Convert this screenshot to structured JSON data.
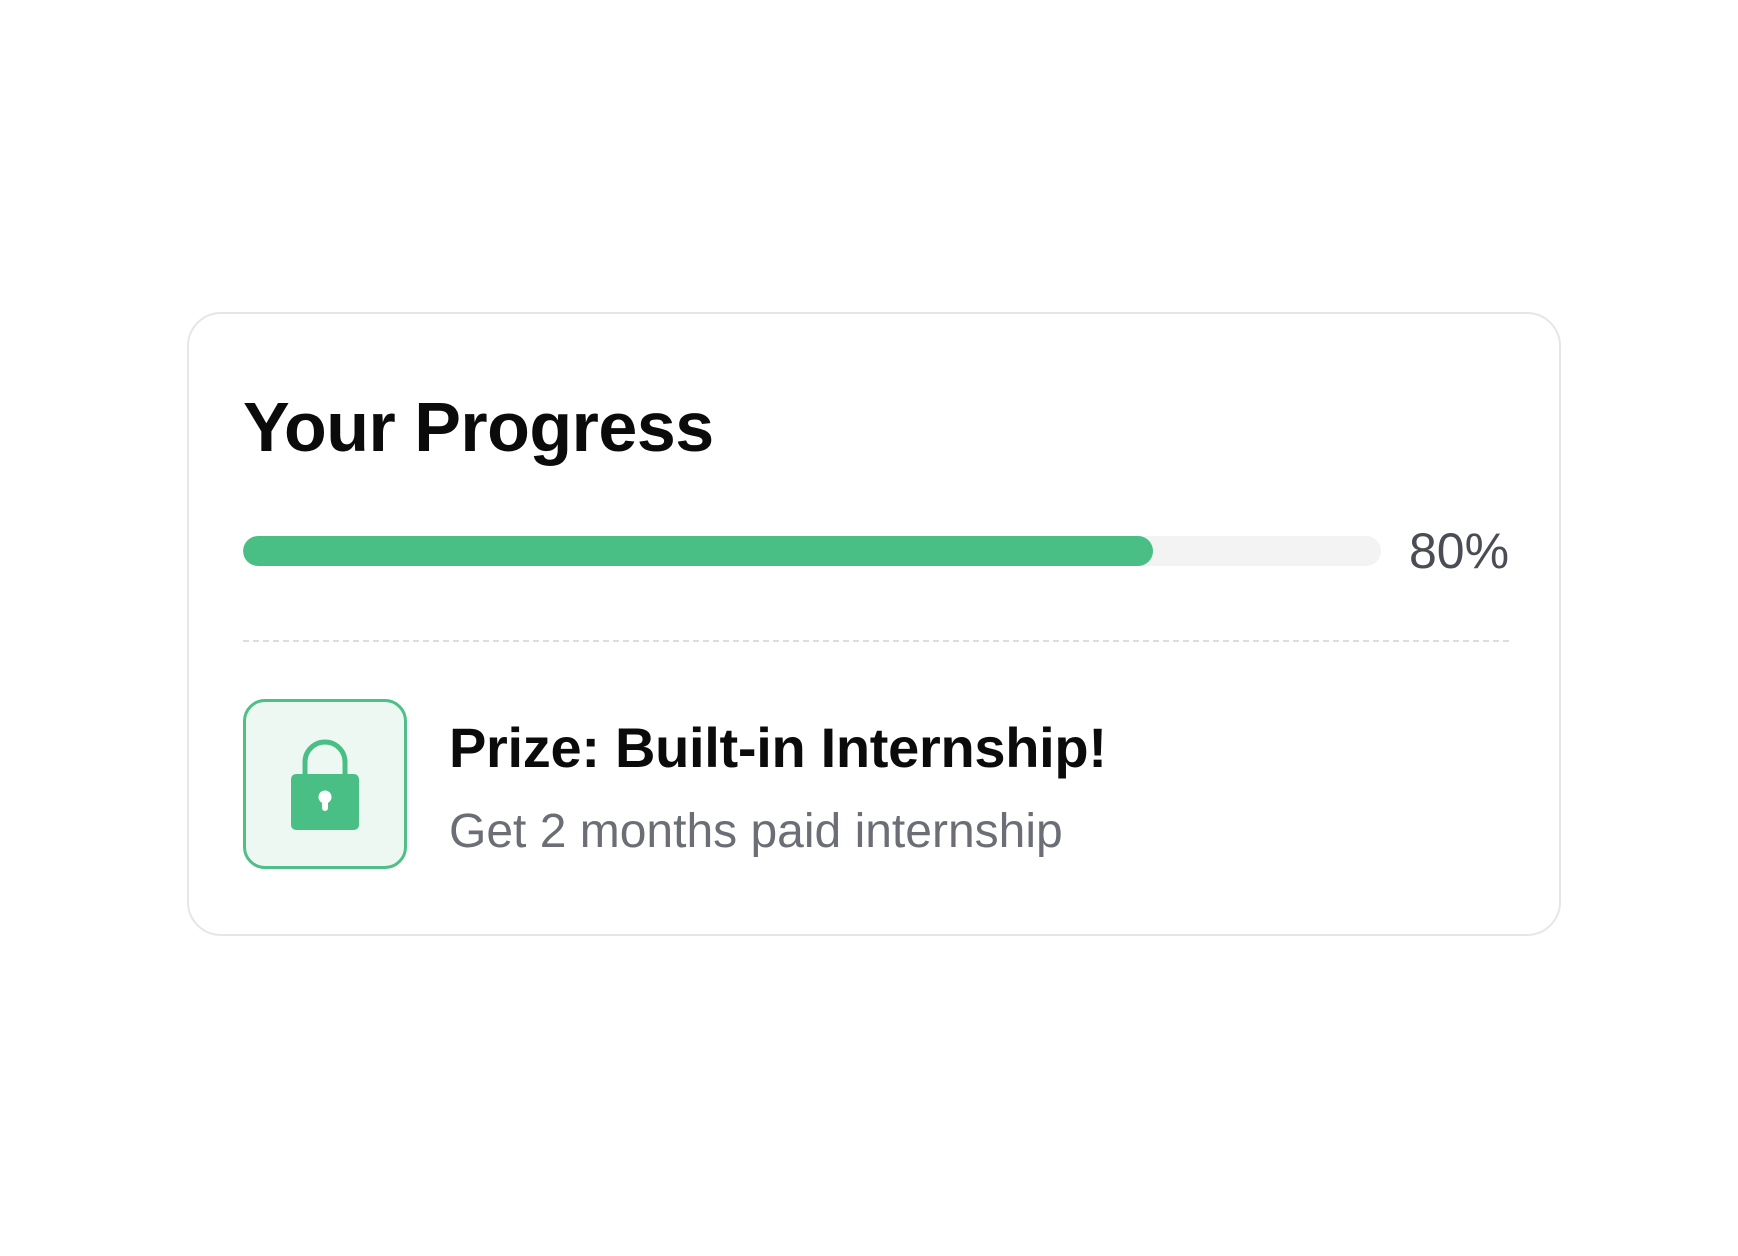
{
  "card": {
    "title": "Your Progress",
    "progress": {
      "percent": 80,
      "label": "80%",
      "fill_color": "#49bf85",
      "track_color": "#f3f3f4"
    },
    "prize": {
      "icon": "lock-icon",
      "title": "Prize: Built-in Internship!",
      "subtitle": "Get 2 months paid internship",
      "accent_color": "#49bf85"
    }
  }
}
